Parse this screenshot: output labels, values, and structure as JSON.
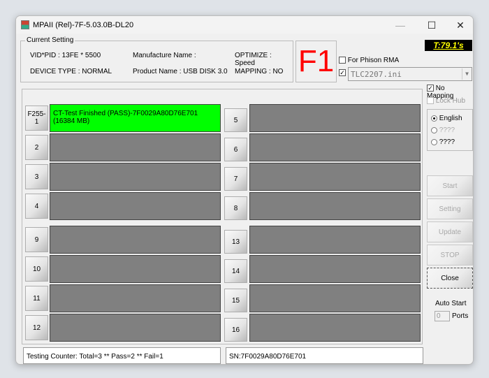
{
  "window": {
    "title": "MPAII (Rel)-7F-5.03.0B-DL20"
  },
  "settings": {
    "legend": "Current Setting",
    "vid_pid": "VID*PID : 13FE * 5500",
    "device_type": "DEVICE TYPE : NORMAL",
    "manufacture": "Manufacture Name :",
    "product": "Product Name : USB DISK 3.0",
    "optimize": "OPTIMIZE : Speed",
    "mapping": "MAPPING : NO"
  },
  "f_label": "F1",
  "timer": "T:79.1's",
  "phison_rma": {
    "label": "For Phison RMA",
    "checked": false
  },
  "ini": {
    "value": "TLC2207.ini",
    "checked": true
  },
  "options": {
    "no_mapping": "No Mapping",
    "lock_hub": "Lock Hub"
  },
  "language": {
    "english": "English",
    "opt2": "????",
    "opt3": "????"
  },
  "buttons": {
    "start": "Start",
    "setting": "Setting",
    "update": "Update",
    "stop": "STOP",
    "close": "Close"
  },
  "auto_start": {
    "label": "Auto Start",
    "value": "0",
    "unit": "Ports"
  },
  "slots": [
    {
      "label": "F255-1",
      "status": "CT-Test Finished (PASS)-7F0029A80D76E701 (16384 MB)",
      "color": "#00ff00"
    },
    {
      "label": "2",
      "status": "",
      "color": "#808080"
    },
    {
      "label": "3",
      "status": "",
      "color": "#808080"
    },
    {
      "label": "4",
      "status": "",
      "color": "#808080"
    },
    {
      "label": "5",
      "status": "",
      "color": "#808080"
    },
    {
      "label": "6",
      "status": "",
      "color": "#808080"
    },
    {
      "label": "7",
      "status": "",
      "color": "#808080"
    },
    {
      "label": "8",
      "status": "",
      "color": "#808080"
    },
    {
      "label": "9",
      "status": "",
      "color": "#808080"
    },
    {
      "label": "10",
      "status": "",
      "color": "#808080"
    },
    {
      "label": "11",
      "status": "",
      "color": "#808080"
    },
    {
      "label": "12",
      "status": "",
      "color": "#808080"
    },
    {
      "label": "13",
      "status": "",
      "color": "#808080"
    },
    {
      "label": "14",
      "status": "",
      "color": "#808080"
    },
    {
      "label": "15",
      "status": "",
      "color": "#808080"
    },
    {
      "label": "16",
      "status": "",
      "color": "#808080"
    }
  ],
  "status_bar": {
    "counter": "Testing Counter: Total=3 ** Pass=2 ** Fail=1",
    "sn": "SN:7F0029A80D76E701"
  }
}
